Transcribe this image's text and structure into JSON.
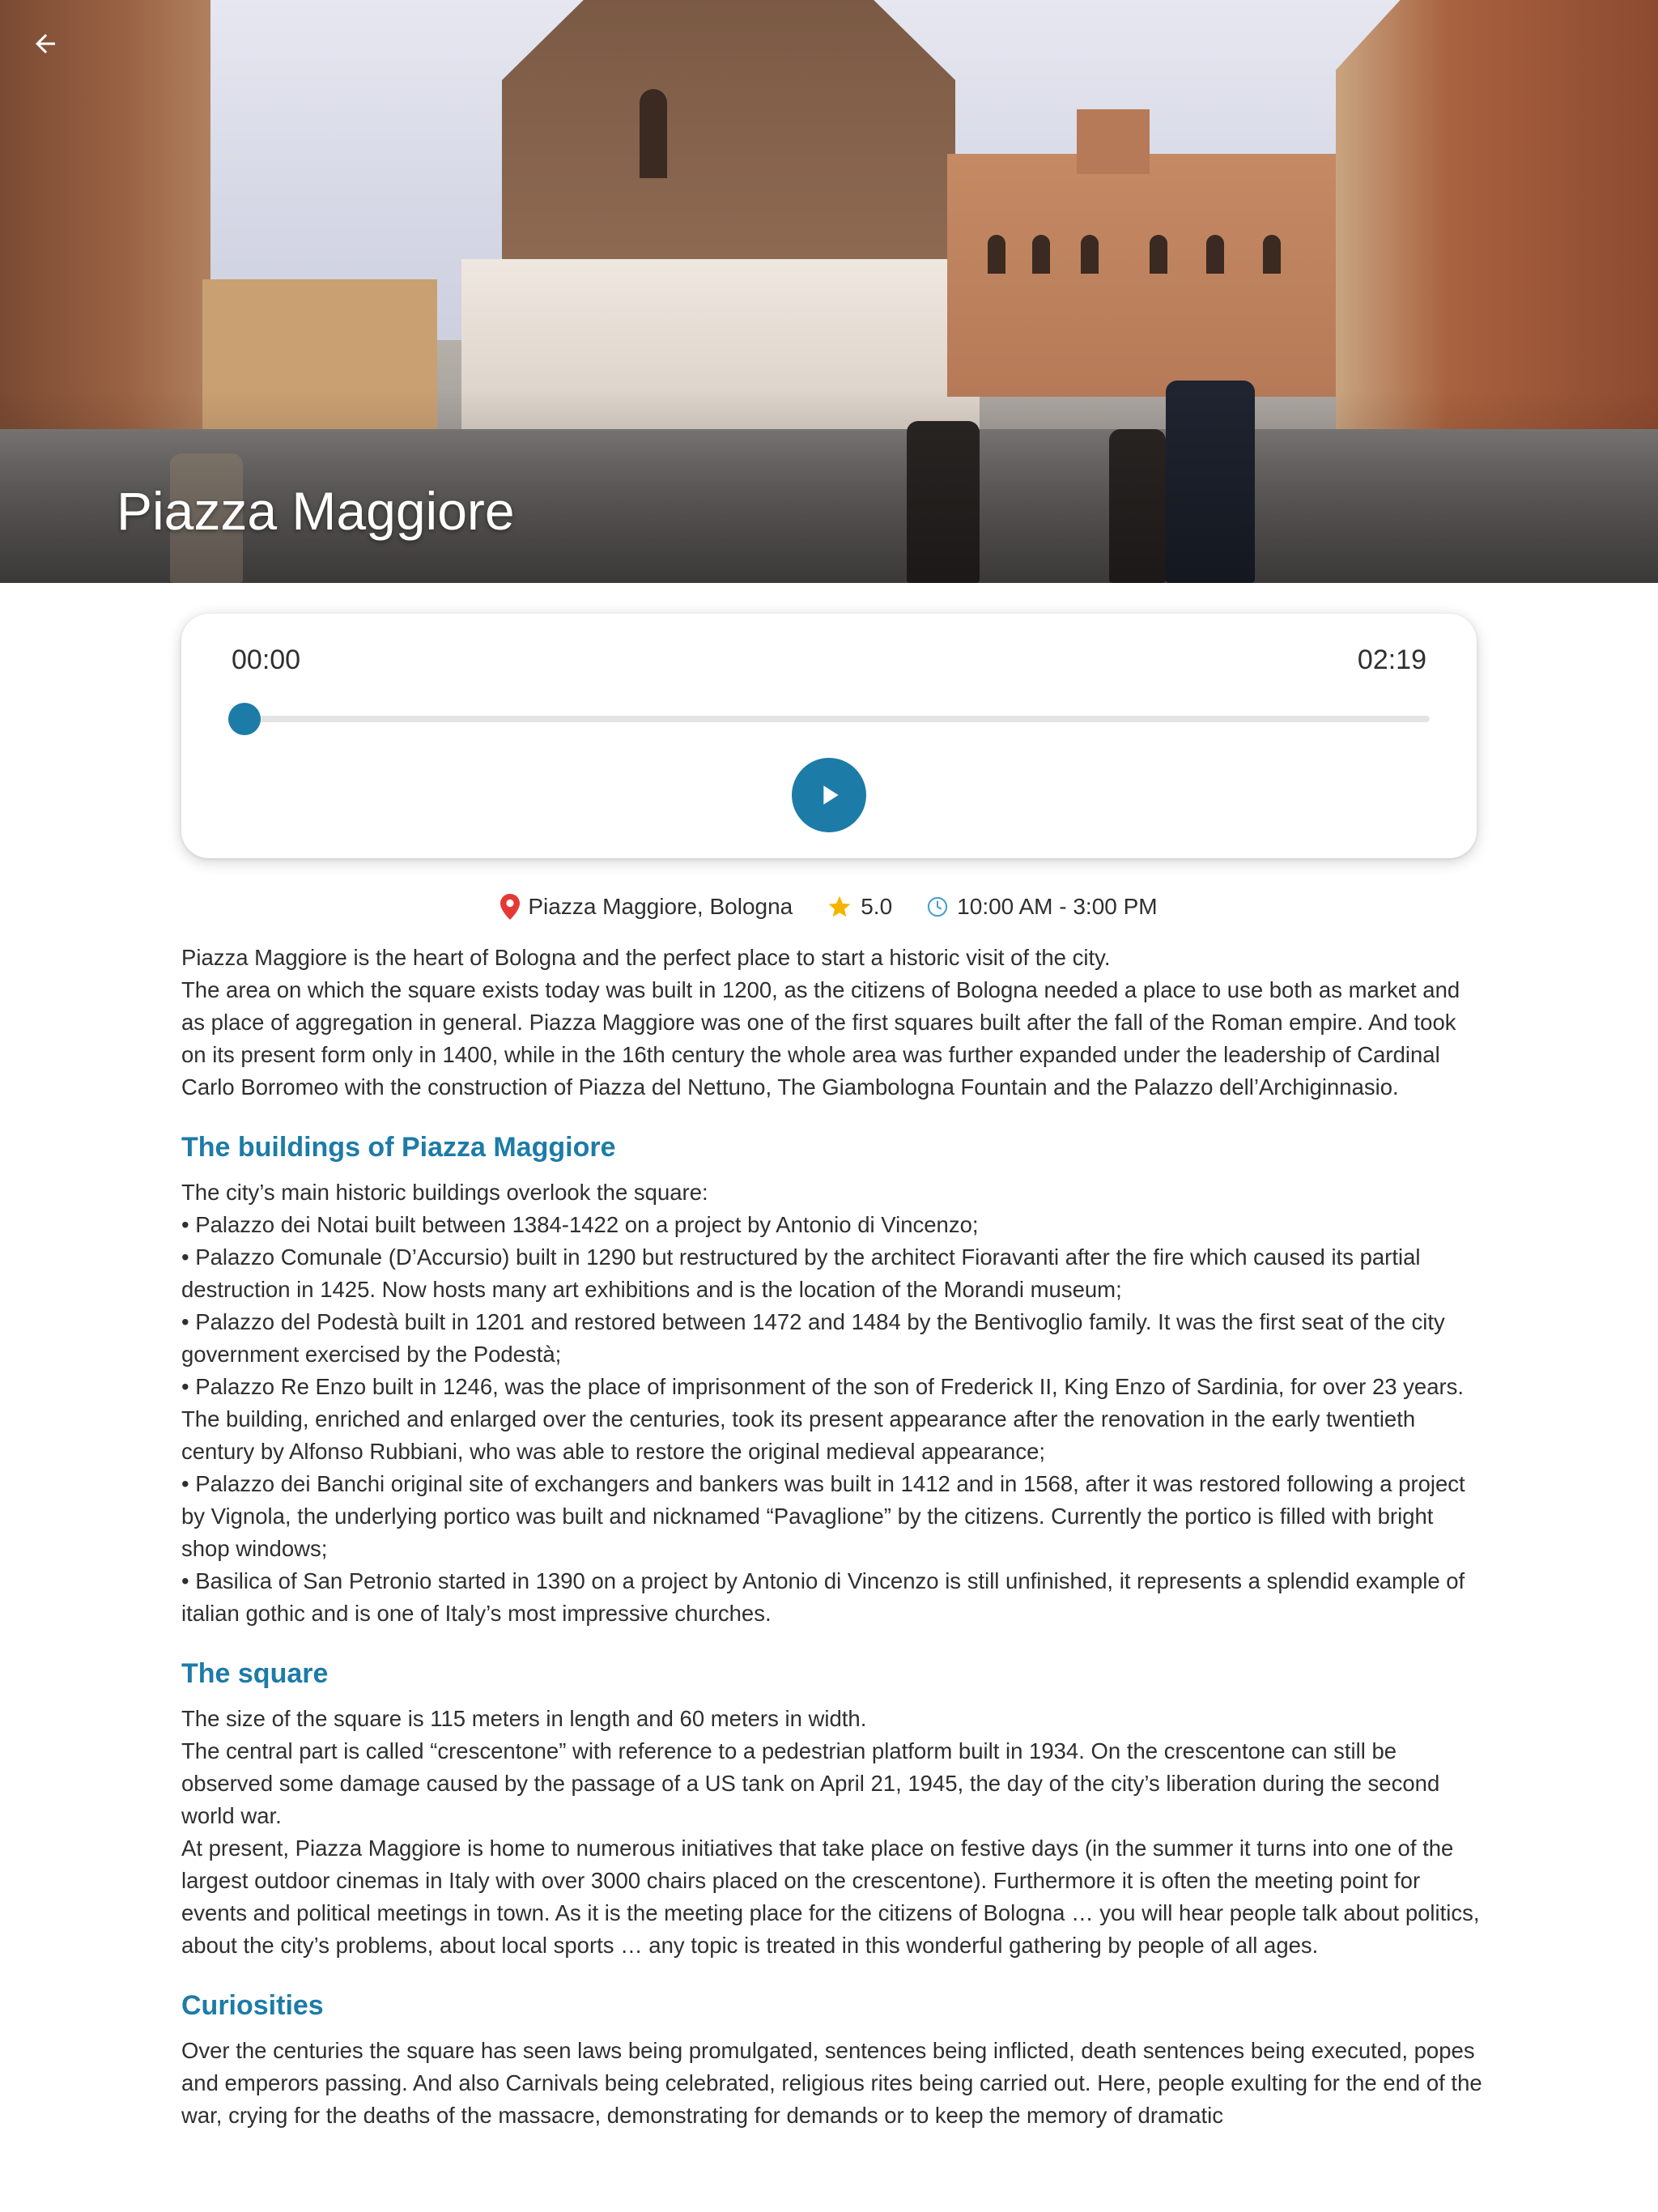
{
  "place": {
    "title": "Piazza Maggiore"
  },
  "player": {
    "current_time": "00:00",
    "total_time": "02:19",
    "progress": 0
  },
  "info": {
    "location": "Piazza Maggiore, Bologna",
    "rating": "5.0",
    "hours": "10:00 AM - 3:00 PM"
  },
  "colors": {
    "accent": "#1d7ba8",
    "pin": "#e53935",
    "star": "#f5b400"
  },
  "icons": {
    "back": "arrow-back-icon",
    "play": "play-icon",
    "location": "location-pin-icon",
    "rating": "star-icon",
    "hours": "clock-icon"
  },
  "article": {
    "intro": [
      "Piazza Maggiore is the heart of Bologna and the perfect place to start a historic visit of the city.",
      "The area on which the square exists today was built in 1200, as the citizens of Bologna needed a place to use both as market and as place of aggregation in general. Piazza Maggiore was one of the first squares built after the fall of the Roman empire. And took on its present form only in 1400, while in the 16th century the whole area was further expanded under the leadership of Cardinal Carlo Borromeo with the construction of Piazza del Nettuno, The Giambologna Fountain and the Palazzo dell’Archiginnasio."
    ],
    "sections": [
      {
        "heading": "The buildings of Piazza Maggiore",
        "paragraphs": [
          "The city’s main historic buildings overlook the square:",
          "• Palazzo dei Notai built between 1384-1422 on a project by Antonio di Vincenzo;",
          "• Palazzo Comunale (D’Accursio) built in 1290 but restructured by the architect Fioravanti after the fire which caused its partial destruction in 1425. Now hosts many art exhibitions and is the location of the Morandi museum;",
          "• Palazzo del Podestà built in 1201 and restored between 1472 and 1484 by the Bentivoglio family. It was the first seat of the city government exercised by the Podestà;",
          "• Palazzo Re Enzo built in 1246, was the place of imprisonment of the son of Frederick II, King Enzo of Sardinia, for over 23 years. The building, enriched and enlarged over the centuries, took its present appearance after the renovation in the early twentieth century by Alfonso Rubbiani, who was able to restore the original medieval appearance;",
          "• Palazzo dei Banchi original site of exchangers and bankers was built in 1412 and in 1568, after it was restored following a project by Vignola, the underlying portico was built and nicknamed “Pavaglione” by the citizens. Currently the portico is filled with bright shop windows;",
          "• Basilica of San Petronio started in 1390 on a project by Antonio di Vincenzo is still unfinished, it represents a splendid example of italian gothic and is one of Italy’s most impressive churches."
        ]
      },
      {
        "heading": "The square",
        "paragraphs": [
          "The size of the square is 115 meters in length and 60 meters in width.",
          "The central part is called “crescentone” with reference to a pedestrian platform built in 1934. On the crescentone can still be observed some damage caused by the passage of a US tank on April 21, 1945, the day of the city’s liberation during the second world war.",
          "At present, Piazza Maggiore is home to numerous initiatives that take place on festive days (in the summer it turns into one of the largest outdoor cinemas in Italy with over 3000 chairs placed on the crescentone). Furthermore it is often the meeting point for events and political meetings in town. As it is the meeting place for the citizens of Bologna … you will hear people talk about politics, about the city’s problems, about local sports … any topic is treated in this wonderful gathering by people of all ages."
        ]
      },
      {
        "heading": "Curiosities",
        "paragraphs": [
          "Over the centuries the square has seen laws being promulgated, sentences being inflicted, death sentences being executed, popes and emperors passing. And also Carnivals being celebrated, religious rites being carried out. Here, people exulting for the end of the war, crying for the deaths of the massacre, demonstrating for demands or to keep the memory of dramatic"
        ]
      }
    ]
  }
}
